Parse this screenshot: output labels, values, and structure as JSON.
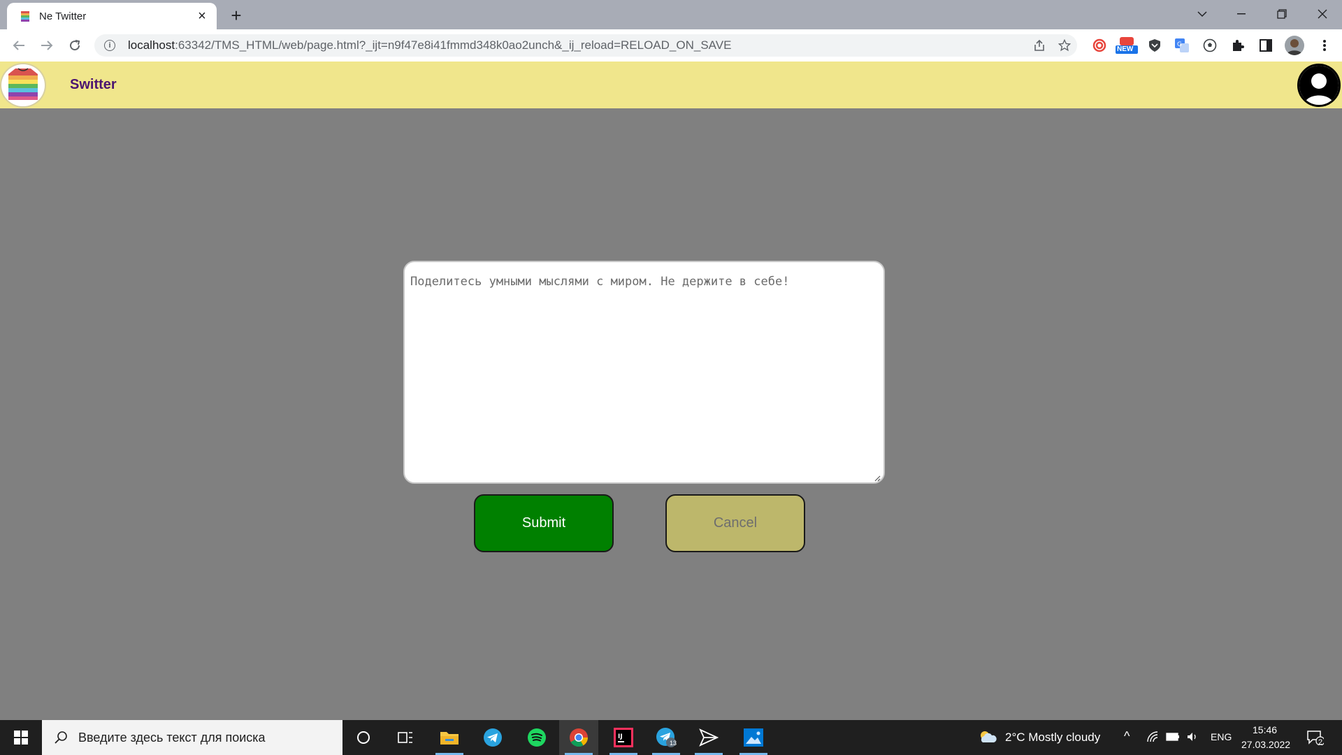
{
  "browser": {
    "tab_title": "Ne Twitter",
    "tab_close": "×",
    "new_tab": "+",
    "url_host": "localhost",
    "url_rest": ":63342/TMS_HTML/web/page.html?_ijt=n9f47e8i41fmmd348k0ao2unch&_ij_reload=RELOAD_ON_SAVE",
    "window_controls": [
      "chevron-down",
      "minimize",
      "restore",
      "close"
    ],
    "extensions": [
      "target-extension",
      "new-badge-extension",
      "shield-extension",
      "translate-extension",
      "soccer-extension",
      "puzzle-extensions",
      "side-panel",
      "profile-avatar",
      "kebab-menu"
    ],
    "new_badge": "NEW"
  },
  "site": {
    "brand": "Switter"
  },
  "composer": {
    "placeholder": "Поделитесь умными мыслями с миром. Не держите в себе!",
    "value": ""
  },
  "actions": {
    "submit_label": "Submit",
    "cancel_label": "Cancel"
  },
  "colors": {
    "page_bg": "#808080",
    "header_bg": "#f0e68c",
    "brand_text": "#4b1470",
    "submit_bg": "#008000",
    "cancel_bg": "#bdb76b"
  },
  "taskbar": {
    "search_placeholder": "Введите здесь текст для поиска",
    "pinned": [
      "cortana",
      "task-view",
      "file-explorer",
      "telegram",
      "spotify",
      "chrome",
      "intellij",
      "telegram-badge",
      "paper-plane",
      "photos"
    ],
    "telegram_badge": "13",
    "weather": "2°C  Mostly cloudy",
    "language": "ENG",
    "time": "15:46",
    "date": "27.03.2022",
    "notifications": "2"
  }
}
